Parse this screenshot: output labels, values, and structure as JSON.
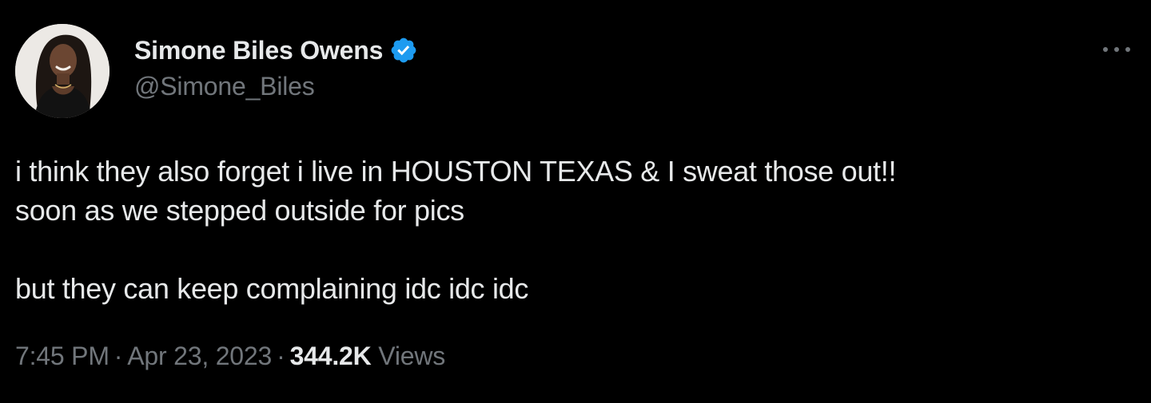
{
  "author": {
    "display_name": "Simone Biles Owens",
    "handle": "@Simone_Biles",
    "verified_icon": "verified-badge-icon",
    "verified_color": "#1d9bf0"
  },
  "tweet": {
    "lines": [
      "i think they also forget i live in HOUSTON TEXAS & I sweat those out!!",
      "soon as we stepped outside for pics",
      "but they can keep complaining idc idc idc"
    ]
  },
  "meta": {
    "time": "7:45 PM",
    "separator": "·",
    "date": "Apr 23, 2023",
    "views_count": "344.2K",
    "views_label": "Views"
  },
  "menu": {
    "icon": "more-options-icon"
  },
  "colors": {
    "background": "#000000",
    "primary_text": "#e7e9ea",
    "secondary_text": "#71767b"
  }
}
